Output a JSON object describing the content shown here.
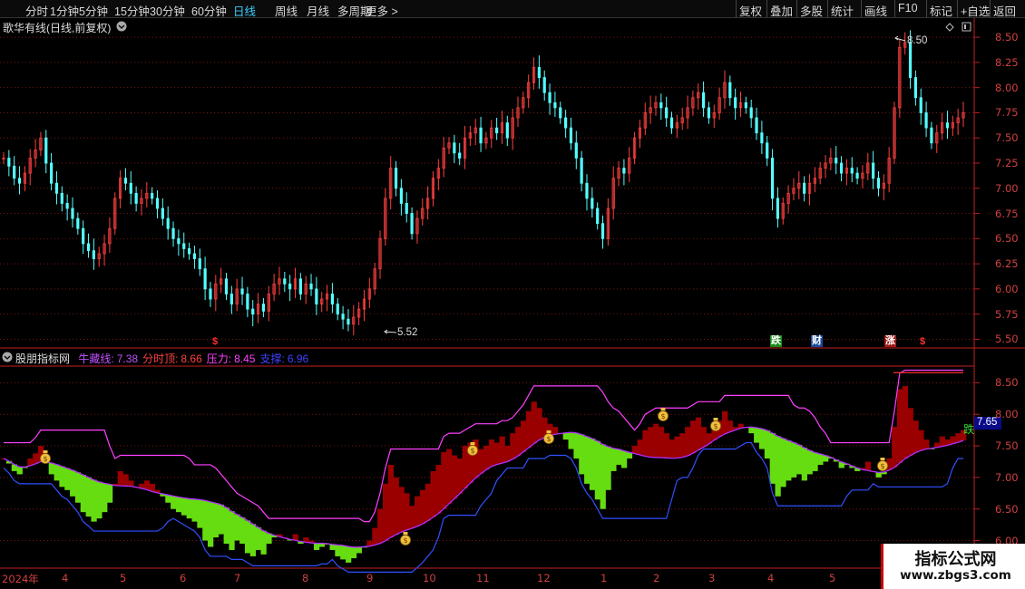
{
  "toolbar": {
    "left_items": [
      "分时",
      "1分钟",
      "5分钟",
      "15分钟",
      "30分钟",
      "60分钟",
      "日线",
      "周线",
      "月线",
      "多周期",
      "更多 >"
    ],
    "active": "日线",
    "right_items": [
      "复权",
      "叠加",
      "多股",
      "统计",
      "画线",
      "F10",
      "标记",
      "+自选",
      "返回"
    ]
  },
  "main_chart": {
    "title": "歌华有线(日线,前复权)",
    "y_ticks": [
      "8.50",
      "8.25",
      "8.00",
      "7.75",
      "7.50",
      "7.25",
      "7.00",
      "6.75",
      "6.50",
      "6.25",
      "6.00",
      "5.75",
      "5.50"
    ],
    "high_label": "8.50",
    "low_label": "5.52",
    "markers": [
      "$",
      "跌",
      "财",
      "涨",
      "$"
    ]
  },
  "indicator": {
    "name": "股朋指标网",
    "fields": [
      {
        "label": "牛藏线:",
        "value": "7.38",
        "color": "#c050ff"
      },
      {
        "label": "分时顶:",
        "value": "8.66",
        "color": "#ff4040"
      },
      {
        "label": "压力:",
        "value": "8.45",
        "color": "#ff40ff"
      },
      {
        "label": "支撑:",
        "value": "6.96",
        "color": "#4040ff"
      }
    ],
    "y_ticks": [
      "8.50",
      "8.00",
      "7.50",
      "7.00",
      "6.50",
      "6.00"
    ],
    "current_value": "7.65",
    "signal": "跌"
  },
  "x_axis": {
    "labels": [
      "2024年",
      "4",
      "5",
      "6",
      "7",
      "8",
      "9",
      "10",
      "11",
      "12",
      "1",
      "2",
      "3",
      "4",
      "5"
    ]
  },
  "watermark": {
    "title": "指标公式网",
    "url": "www.zbgs3.com"
  },
  "colors": {
    "up": "#ff4040",
    "down": "#54ffff",
    "fill_up": "#9a0000",
    "fill_down": "#66dd11",
    "axis": "#d03030",
    "active_tab": "#39d0ff"
  },
  "chart_data": {
    "type": "candlestick",
    "ylim": [
      5.45,
      8.6
    ],
    "closes": [
      7.3,
      7.22,
      7.1,
      7.05,
      7.15,
      7.3,
      7.38,
      7.5,
      7.25,
      7.05,
      6.95,
      6.85,
      6.8,
      6.7,
      6.6,
      6.45,
      6.38,
      6.3,
      6.35,
      6.45,
      6.6,
      6.9,
      7.1,
      7.05,
      6.95,
      6.85,
      6.9,
      6.95,
      6.9,
      6.8,
      6.7,
      6.6,
      6.5,
      6.45,
      6.4,
      6.35,
      6.3,
      6.2,
      6.0,
      5.9,
      6.05,
      6.1,
      5.95,
      5.85,
      6.0,
      5.95,
      5.8,
      5.75,
      5.85,
      5.78,
      5.95,
      6.05,
      6.1,
      6.05,
      6.0,
      6.1,
      5.95,
      6.05,
      6.0,
      5.85,
      5.9,
      5.95,
      5.85,
      5.75,
      5.7,
      5.65,
      5.72,
      5.8,
      5.9,
      6.0,
      6.2,
      6.5,
      6.9,
      7.2,
      7.0,
      6.85,
      6.75,
      6.55,
      6.7,
      6.8,
      6.9,
      7.1,
      7.2,
      7.4,
      7.45,
      7.35,
      7.3,
      7.5,
      7.55,
      7.6,
      7.45,
      7.5,
      7.6,
      7.55,
      7.65,
      7.5,
      7.7,
      7.8,
      7.9,
      8.05,
      8.2,
      8.1,
      7.95,
      7.85,
      7.8,
      7.7,
      7.6,
      7.45,
      7.3,
      7.05,
      6.9,
      6.8,
      6.65,
      6.5,
      6.8,
      7.1,
      7.2,
      7.15,
      7.3,
      7.5,
      7.6,
      7.75,
      7.8,
      7.85,
      7.8,
      7.7,
      7.6,
      7.65,
      7.7,
      7.8,
      7.9,
      7.95,
      7.8,
      7.7,
      7.75,
      7.9,
      8.05,
      7.9,
      7.8,
      7.85,
      7.8,
      7.7,
      7.55,
      7.45,
      7.3,
      6.9,
      6.7,
      6.85,
      6.95,
      7.0,
      7.05,
      6.95,
      7.05,
      7.1,
      7.2,
      7.25,
      7.3,
      7.25,
      7.15,
      7.2,
      7.15,
      7.1,
      7.15,
      7.25,
      7.1,
      7.0,
      7.05,
      7.3,
      7.8,
      8.4,
      8.45,
      8.1,
      7.9,
      7.75,
      7.6,
      7.45,
      7.55,
      7.65,
      7.6,
      7.65,
      7.7,
      7.75
    ]
  }
}
